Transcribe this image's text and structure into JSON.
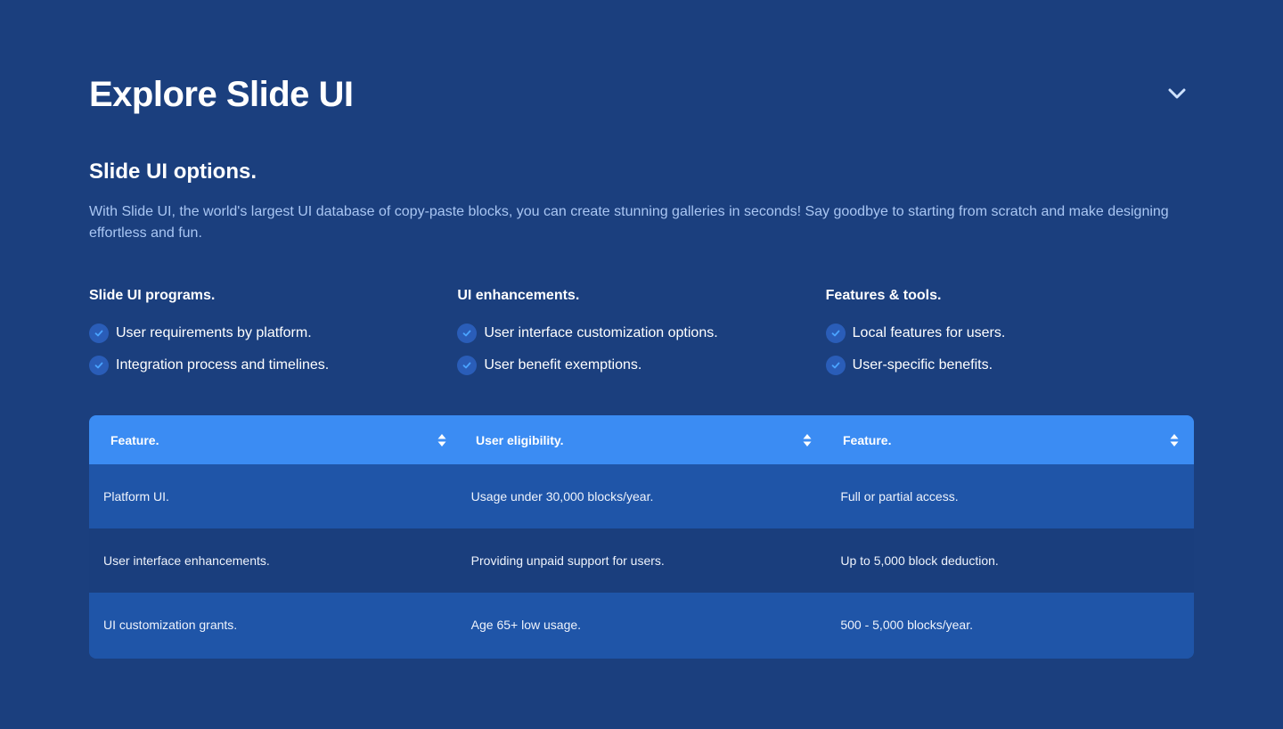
{
  "header": {
    "title": "Explore Slide UI",
    "toggle_icon": "chevron-down-icon"
  },
  "intro": {
    "title": "Slide UI options.",
    "description": "With Slide UI, the world's largest UI database of copy-paste blocks, you can create stunning galleries in seconds! Say goodbye to starting from scratch and make designing effortless and fun."
  },
  "columns": [
    {
      "title": "Slide UI programs.",
      "items": [
        "User requirements by platform.",
        "Integration process and timelines."
      ]
    },
    {
      "title": "UI enhancements.",
      "items": [
        "User interface customization options.",
        "User benefit exemptions."
      ]
    },
    {
      "title": "Features & tools.",
      "items": [
        "Local features for users.",
        "User-specific benefits."
      ]
    }
  ],
  "table": {
    "headers": [
      "Feature.",
      "User eligibility.",
      "Feature."
    ],
    "rows": [
      [
        "Platform UI.",
        "Usage under 30,000 blocks/year.",
        "Full or partial access."
      ],
      [
        "User interface enhancements.",
        "Providing unpaid support for users.",
        "Up to 5,000 block deduction."
      ],
      [
        "UI customization grants.",
        "Age 65+ low usage.",
        "500 - 5,000 blocks/year."
      ]
    ]
  },
  "colors": {
    "background": "#1b3f7e",
    "table_header": "#3b8cf3",
    "row_light": "#1f55a8",
    "row_dark": "#1a3e7d",
    "check_accent": "#4aa3ff",
    "description_text": "#a9c6f3"
  }
}
